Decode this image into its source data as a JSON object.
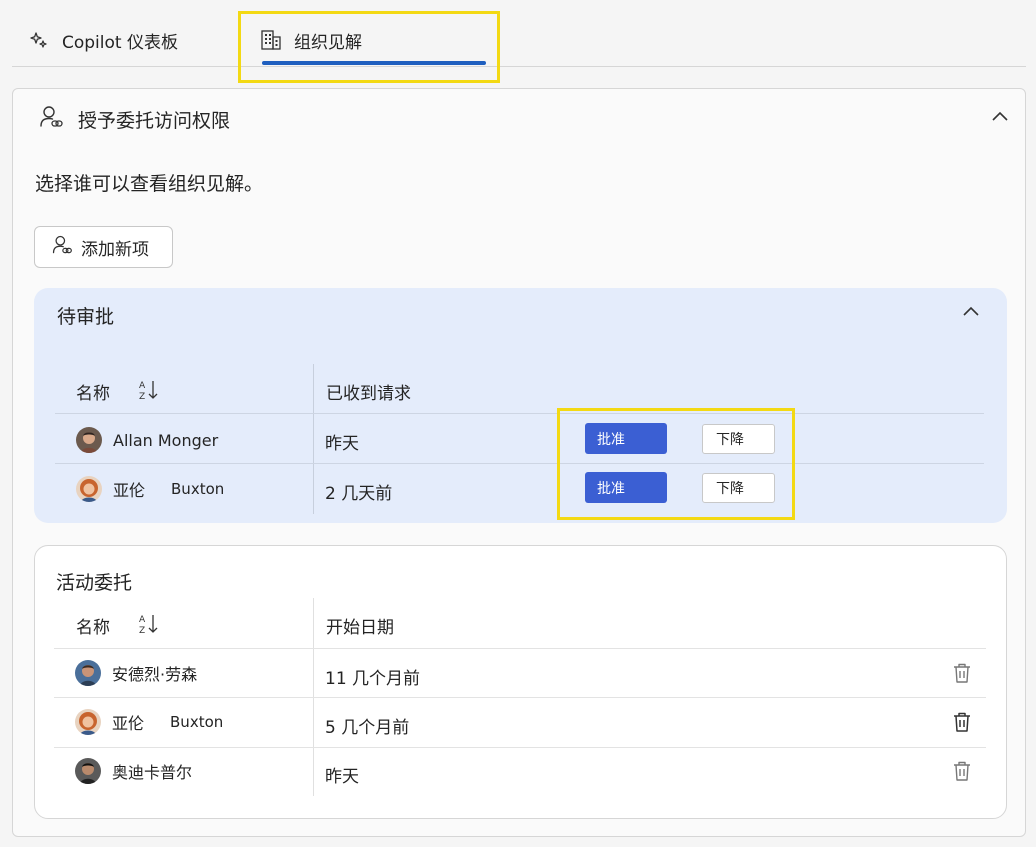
{
  "tabs": [
    {
      "label": "Copilot 仪表板",
      "icon": "sparkle-icon"
    },
    {
      "label": "组织见解",
      "icon": "building-icon",
      "selected": true
    }
  ],
  "section": {
    "title": "授予委托访问权限",
    "description": "选择谁可以查看组织见解。",
    "add_button": "添加新项"
  },
  "pending": {
    "title": "待审批",
    "columns": [
      "名称",
      "已收到请求"
    ],
    "rows": [
      {
        "name": "Allan Monger",
        "name_extra": "",
        "received": "昨天",
        "approve": "批准",
        "decline": "下降"
      },
      {
        "name": "亚伦",
        "name_extra": "Buxton",
        "received": "2 几天前",
        "approve": "批准",
        "decline": "下降"
      }
    ]
  },
  "active": {
    "title": "活动委托",
    "columns": [
      "名称",
      "开始日期"
    ],
    "rows": [
      {
        "name": "安德烈·劳森",
        "name_extra": "",
        "start": "11 几个月前"
      },
      {
        "name": "亚伦",
        "name_extra": "Buxton",
        "start": "5 几个月前"
      },
      {
        "name": "奥迪卡普尔",
        "name_extra": "",
        "start": "昨天"
      }
    ]
  },
  "colors": {
    "accent": "#1f5fbf",
    "approve": "#3b5fd3",
    "pending_bg": "#e4ecfb",
    "highlight": "#f3d913"
  }
}
